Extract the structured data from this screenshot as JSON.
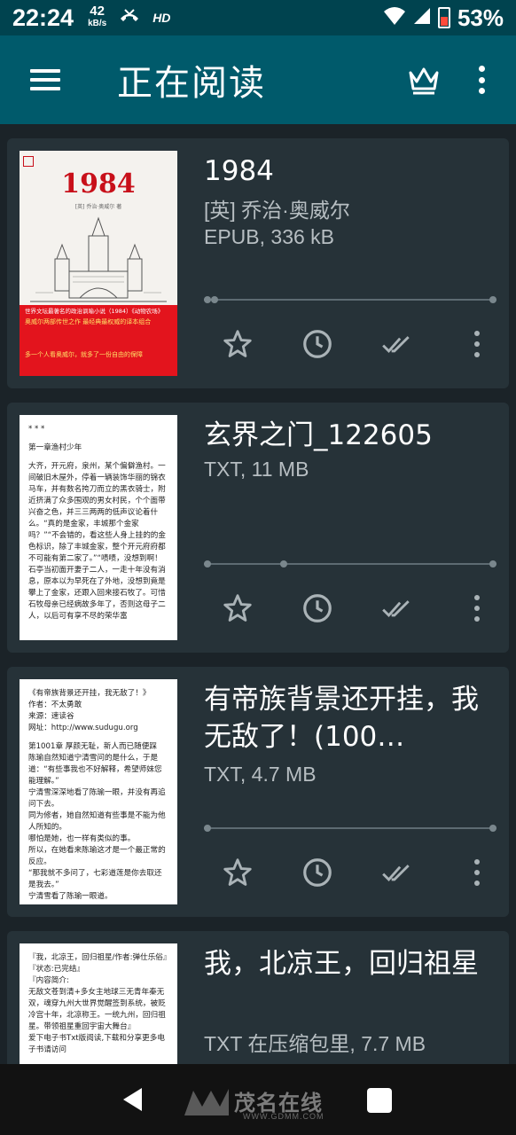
{
  "status_bar": {
    "time": "22:24",
    "net_speed": "42",
    "net_unit": "kB/s",
    "hd": "HD",
    "battery": "53%"
  },
  "app_bar": {
    "title": "正在阅读",
    "menu_icon": "hamburger-menu-icon",
    "crown_icon": "crown-icon",
    "more_icon": "more-vert-icon"
  },
  "books": [
    {
      "title": "1984",
      "author": "[英] 乔治·奥威尔",
      "meta": "EPUB, 336 kB",
      "progress": 0.0,
      "cover": {
        "title": "1984",
        "subtitle": "[英] 乔治·奥威尔 著",
        "band_lines": [
          "世界文坛最著名的政治讽喻小说（1984）《动物农场》",
          "奥威尔两部传世之作  最经典最权威的译本组合",
          "多一个人看奥威尔，就多了一份自由的保障"
        ]
      }
    },
    {
      "title": "玄界之门_122605",
      "meta": "TXT, 11 MB",
      "progress": 0.3,
      "cover_text": [
        "* * *",
        "第一章渔村少年",
        "大齐，开元府，泉州，某个偏僻渔村。一间破旧木屋外，停着一辆装饰华丽的锦衣马车，并有数名挎刀而立的黑衣骑士，附近挤满了众多围观的男女村民，个个面带兴奋之色，并三三两两的低声议论着什么。“真的是金家，丰城那个金家吗？”“不会错的，看这些人身上挂的的金色标识，除了丰城金家，整个开元府府都不可能有第二家了。”“啧啧，没想到啊！石亭当初面开妻子二人，一走十年没有消息，原本以为早死在了外地，没想到竟是攀上了金家，还跟入回来接石牧了。可惜石牧母亲已经病故多年了，否则这母子二人，以后可有享不尽的荣华富"
      ]
    },
    {
      "title": "有帝族背景还开挂，我无敌了！(100…",
      "meta": "TXT, 4.7 MB",
      "progress": 0.0,
      "cover_text": [
        "《有帝族背景还开挂，我无敌了！》",
        "作者：不太勇敢",
        "来源：速读谷",
        "网址：http://www.sudugu.org",
        "第1001章 厚颜无耻，新人而已随便踩",
        "陈瑜自然知道宁清雪问的是什么，于是道：“有些事我也不好解释，希望师妹您能理解。”",
        "宁清雪深深地看了陈瑜一眼，并没有再追问下去。",
        "同为修者，她自然知道有些事是不能为他人所知的。",
        "哪怕是她，也一样有类似的事。",
        "所以，在她看来陈瑜这才是一个最正常的反应。",
        "“那我就不多问了，七彩道莲是你去取还是我去。”",
        "宁清雪看了陈瑜一眼道。"
      ]
    },
    {
      "title": "我，北凉王，回归祖星",
      "meta": "TXT 在压缩包里, 7.7 MB",
      "cover_text": [
        "『我，北凉王，回归祖星/作者:弹仕乐俗』",
        "『状态:已完结』",
        "『内容简介:",
        "无敌文苍到清+多女主地球三无青年秦无双，魂穿九州大世界觉醒签到系统，被贬冷宫十年，北凉称王。一统九州，回归祖星。带领祖星重回宇宙大舞台』",
        "爱下电子书Txt版阅读,下载和分享更多电子书请访问"
      ]
    }
  ],
  "nav_bar": {
    "watermark": "茂名在线",
    "watermark_url": "WWW.GDMM.COM"
  }
}
